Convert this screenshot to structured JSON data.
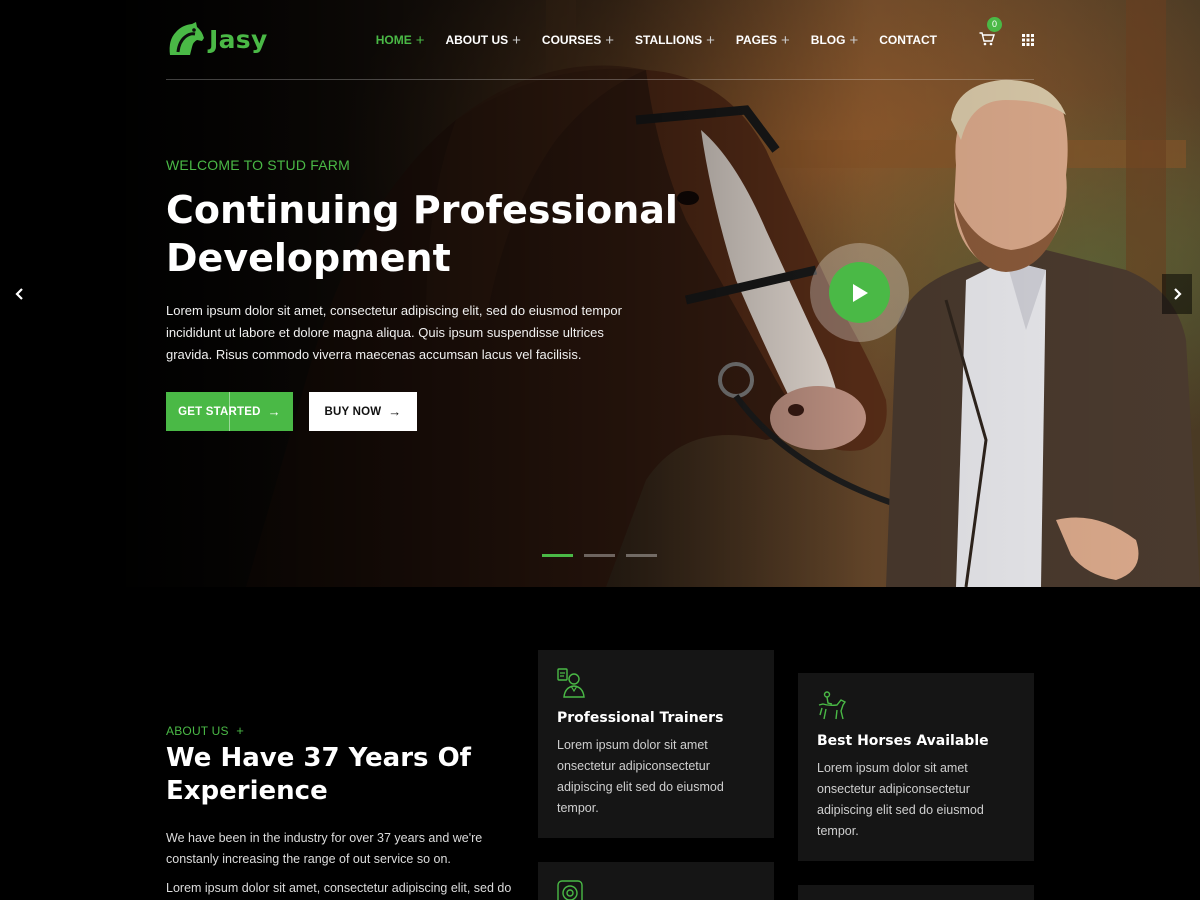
{
  "brand": {
    "name": "Jasy",
    "accent": "#4ab946"
  },
  "nav": {
    "items": [
      {
        "label": "HOME",
        "has_submenu": true,
        "active": true
      },
      {
        "label": "ABOUT US",
        "has_submenu": true
      },
      {
        "label": "COURSES",
        "has_submenu": true
      },
      {
        "label": "STALLIONS",
        "has_submenu": true
      },
      {
        "label": "PAGES",
        "has_submenu": true
      },
      {
        "label": "BLOG",
        "has_submenu": true
      },
      {
        "label": "CONTACT",
        "has_submenu": false
      }
    ],
    "cart_count": "0",
    "icons": [
      "cart-icon",
      "grid-menu-icon"
    ]
  },
  "hero": {
    "eyebrow": "WELCOME TO STUD FARM",
    "title_line1": "Continuing Professional",
    "title_line2": "Development",
    "description": "Lorem ipsum dolor sit amet, consectetur adipiscing elit, sed do eiusmod tempor incididunt ut labore et dolore magna aliqua. Quis ipsum suspendisse ultrices gravida. Risus commodo viverra maecenas accumsan lacus vel facilisis.",
    "primary_button": "GET STARTED",
    "secondary_button": "BUY NOW",
    "slide_count": 3,
    "active_slide": 1
  },
  "about": {
    "eyebrow": "ABOUT US",
    "title": "We Have 37 Years Of Experience",
    "paragraph1": "We have been in the industry for over 37 years and we're constanly increasing the range of out service so on.",
    "paragraph2": "Lorem ipsum dolor sit amet, consectetur adipiscing elit, sed do"
  },
  "features": [
    {
      "icon": "trainer-icon",
      "title": "Professional Trainers",
      "description": "Lorem ipsum dolor sit amet onsectetur adipiconsectetur adipiscing elit sed do eiusmod tempor."
    },
    {
      "icon": "rider-horse-icon",
      "title": "Best Horses Available",
      "description": "Lorem ipsum dolor sit amet onsectetur adipiconsectetur adipiscing elit sed do eiusmod tempor."
    },
    {
      "icon": "target-icon",
      "title": "",
      "description": ""
    },
    {
      "icon": "",
      "title": "",
      "description": ""
    }
  ]
}
